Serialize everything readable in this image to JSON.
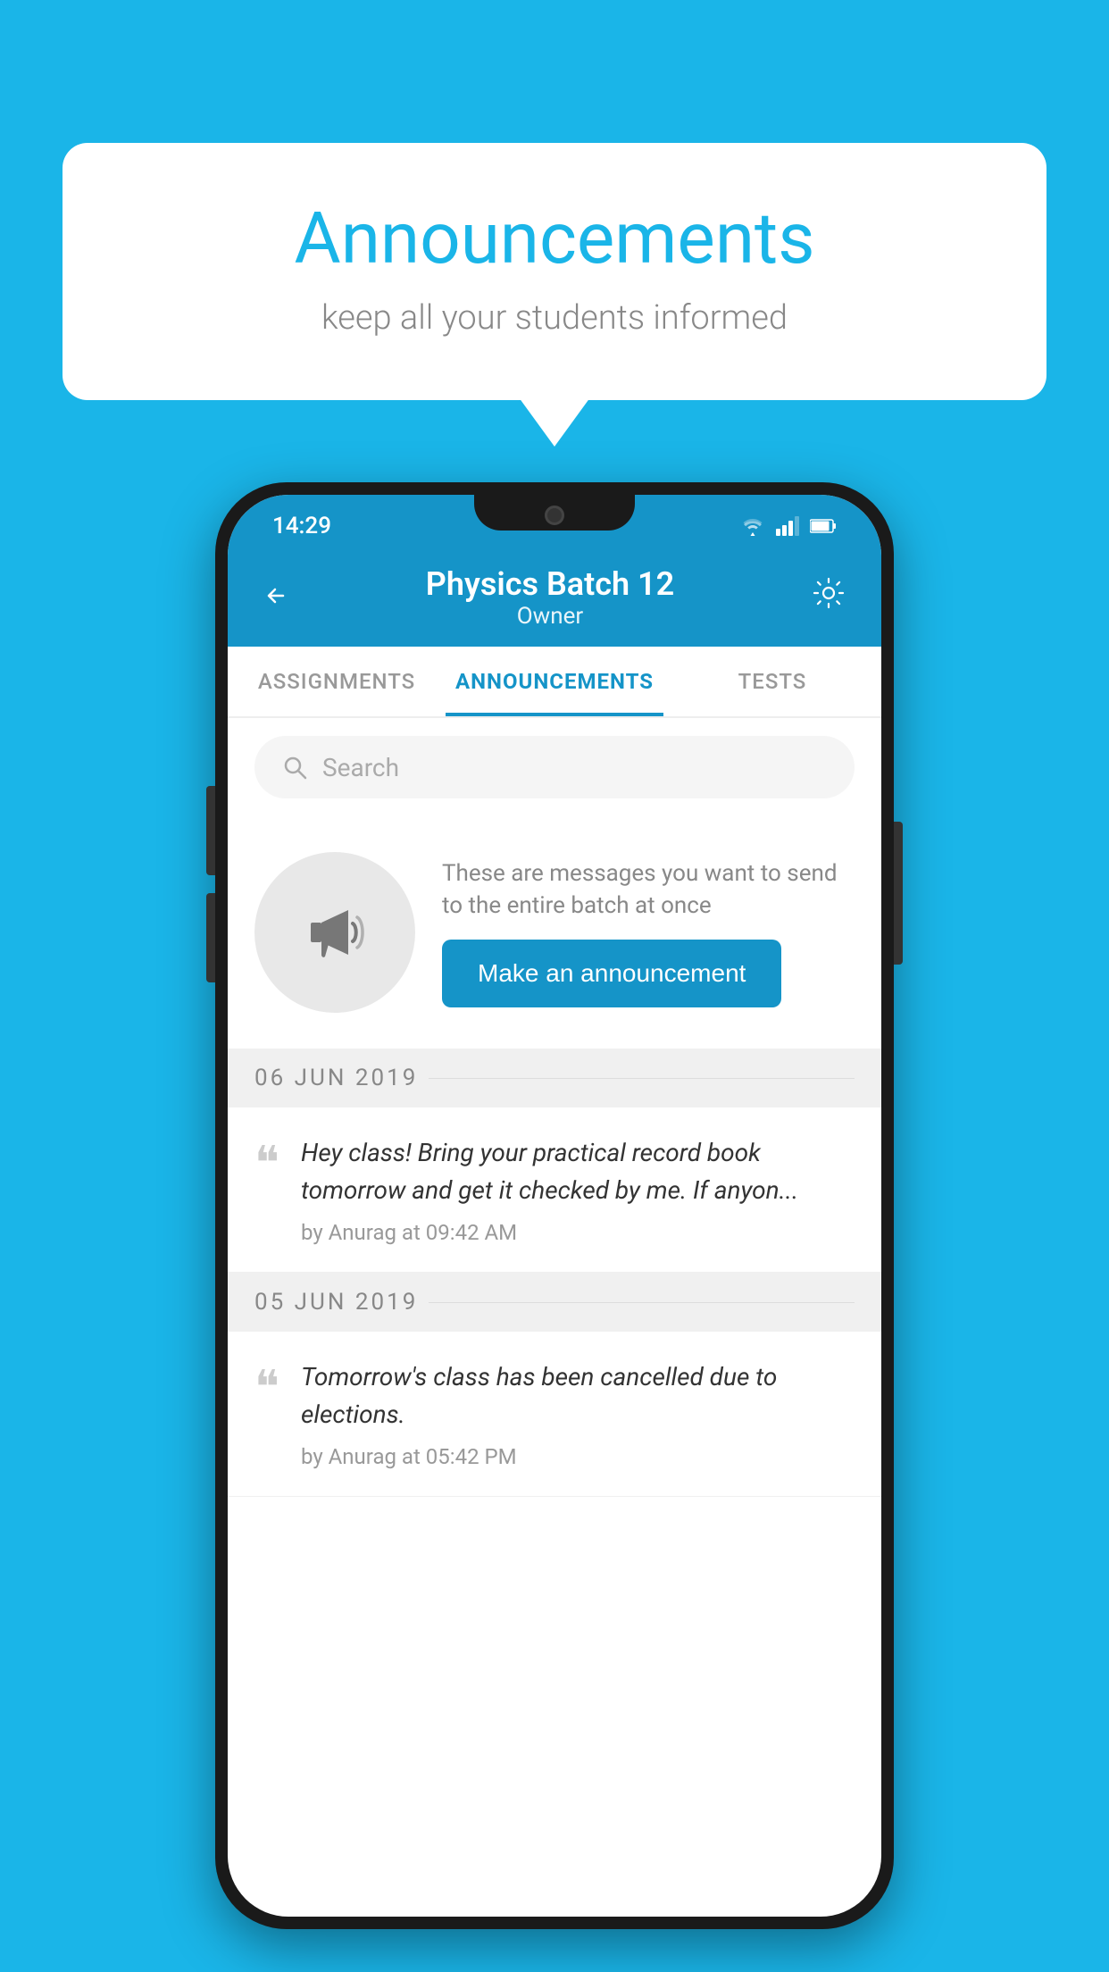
{
  "background_color": "#1ab5e8",
  "speech_bubble": {
    "title": "Announcements",
    "subtitle": "keep all your students informed"
  },
  "phone": {
    "status_bar": {
      "time": "14:29",
      "icons": [
        "wifi",
        "signal",
        "battery"
      ]
    },
    "app_bar": {
      "title": "Physics Batch 12",
      "subtitle": "Owner",
      "back_label": "←",
      "settings_label": "⚙"
    },
    "tabs": [
      {
        "label": "ASSIGNMENTS",
        "active": false
      },
      {
        "label": "ANNOUNCEMENTS",
        "active": true
      },
      {
        "label": "TESTS",
        "active": false
      }
    ],
    "search": {
      "placeholder": "Search"
    },
    "announcement_prompt": {
      "description": "These are messages you want to send to the entire batch at once",
      "button_label": "Make an announcement"
    },
    "announcements": [
      {
        "date": "06  JUN  2019",
        "text": "Hey class! Bring your practical record book tomorrow and get it checked by me. If anyon...",
        "meta": "by Anurag at 09:42 AM"
      },
      {
        "date": "05  JUN  2019",
        "text": "Tomorrow's class has been cancelled due to elections.",
        "meta": "by Anurag at 05:42 PM"
      }
    ]
  }
}
